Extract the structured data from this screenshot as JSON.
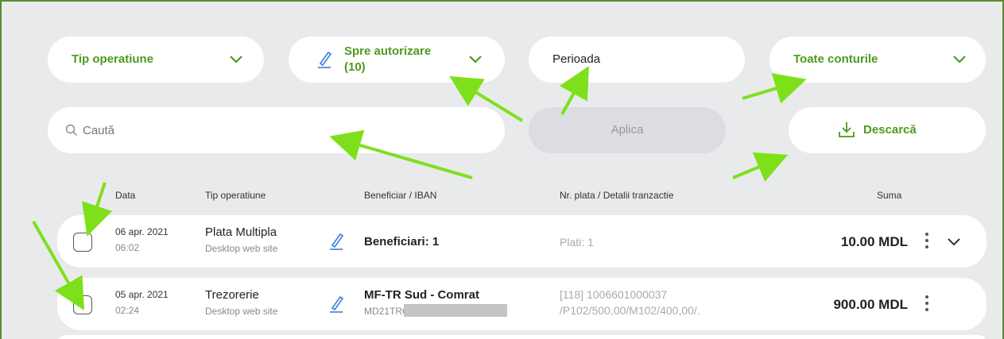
{
  "filters": {
    "tip_operatiune": "Tip operatiune",
    "spre_autorizare_line1": "Spre autorizare",
    "spre_autorizare_line2": "(10)",
    "perioada": "Perioada",
    "toate_conturile": "Toate conturile"
  },
  "search": {
    "placeholder": "Caută"
  },
  "buttons": {
    "aplica": "Aplica",
    "descarca": "Descarcă"
  },
  "columns": {
    "data": "Data",
    "tip": "Tip operatiune",
    "beneficiar": "Beneficiar / IBAN",
    "nr_plata": "Nr. plata / Detalii tranzactie",
    "suma": "Suma"
  },
  "rows": [
    {
      "date": "06 apr. 2021",
      "time": "06:02",
      "type": "Plata Multipla",
      "source": "Desktop web site",
      "beneficiary": "Beneficiari: 1",
      "iban": "",
      "details_line1": "Plati: 1",
      "details_line2": "",
      "amount": "10.00 MDL"
    },
    {
      "date": "05 apr. 2021",
      "time": "02:24",
      "type": "Trezorerie",
      "source": "Desktop web site",
      "beneficiary": "MF-TR Sud - Comrat",
      "iban": "MD21TRGDA",
      "details_line1": "[118] 1006601000037",
      "details_line2": "/P102/500,00/M102/400,00/.",
      "amount": "900.00 MDL"
    }
  ],
  "colors": {
    "accent": "#4c9a1e",
    "annotation_arrow": "#7ee01a",
    "frame": "#5a8a32",
    "background": "#e9eaec"
  }
}
